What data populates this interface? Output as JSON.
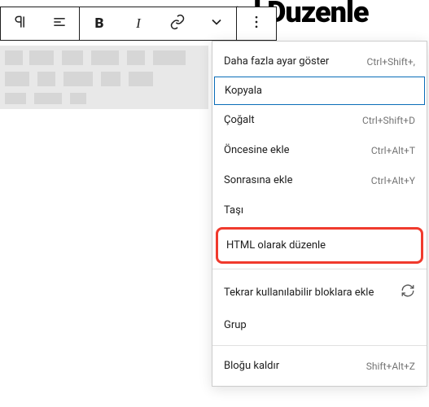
{
  "title_fragment": "urul Duzenle",
  "toolbar": {
    "paragraph_icon": "paragraph",
    "align_icon": "align",
    "bold": "B",
    "italic": "I",
    "link_icon": "link",
    "chevron_icon": "chevron",
    "more_icon": "more"
  },
  "menu": {
    "items": [
      {
        "label": "Daha fazla ayar göster",
        "shortcut": "Ctrl+Shift+,"
      },
      {
        "label": "Kopyala",
        "shortcut": ""
      },
      {
        "label": "Çoğalt",
        "shortcut": "Ctrl+Shift+D"
      },
      {
        "label": "Öncesine ekle",
        "shortcut": "Ctrl+Alt+T"
      },
      {
        "label": "Sonrasına ekle",
        "shortcut": "Ctrl+Alt+Y"
      },
      {
        "label": "Taşı",
        "shortcut": ""
      },
      {
        "label": "HTML olarak düzenle",
        "shortcut": ""
      },
      {
        "label": "Tekrar kullanılabilir bloklara ekle",
        "shortcut": "",
        "icon": "refresh"
      },
      {
        "label": "Grup",
        "shortcut": ""
      },
      {
        "label": "Bloğu kaldır",
        "shortcut": "Shift+Alt+Z"
      }
    ]
  }
}
